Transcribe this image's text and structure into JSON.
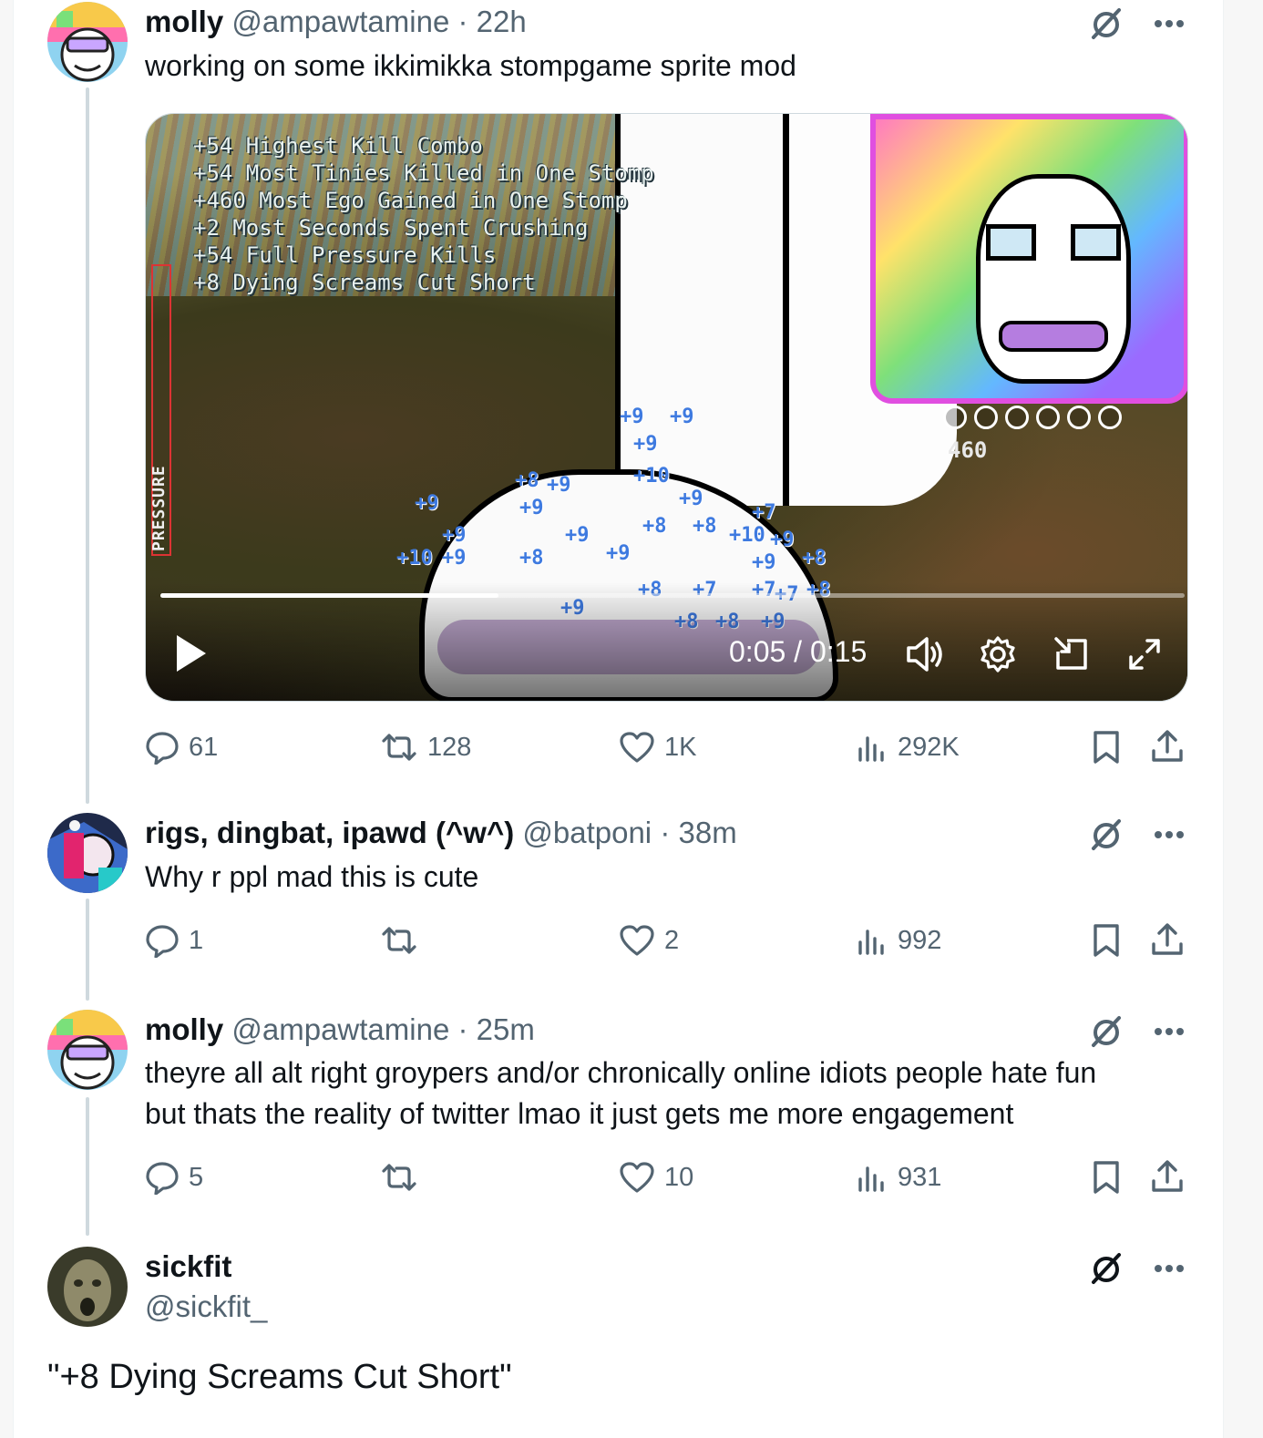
{
  "colors": {
    "text": "#0f1419",
    "muted": "#536471",
    "line": "#cfd9de"
  },
  "posts": [
    {
      "name": "molly",
      "handle": "@ampawtamine",
      "sep": "·",
      "time": "22h",
      "text": "working on some ikkimikka stompgame sprite mod",
      "stats": {
        "replies": "61",
        "reposts": "128",
        "likes": "1K",
        "views": "292K"
      }
    },
    {
      "name": "rigs, dingbat, ipawd (^w^)",
      "handle": "@batponi",
      "sep": "·",
      "time": "38m",
      "text": "Why r ppl mad this is cute",
      "stats": {
        "replies": "1",
        "reposts": "",
        "likes": "2",
        "views": "992"
      }
    },
    {
      "name": "molly",
      "handle": "@ampawtamine",
      "sep": "·",
      "time": "25m",
      "text_line1": "theyre all alt right groypers and/or chronically online idiots people hate fun",
      "text_line2": "but thats the reality of twitter lmao it just gets me more engagement",
      "stats": {
        "replies": "5",
        "reposts": "",
        "likes": "10",
        "views": "931"
      }
    },
    {
      "name": "sickfit",
      "handle": "@sickfit_",
      "quote": "\"+8 Dying Screams Cut Short\""
    }
  ],
  "video": {
    "hud_lines": "+54 Highest Kill Combo\n+54 Most Tinies Killed in One Stomp\n+460 Most Ego Gained in One Stomp\n+2 Most Seconds Spent Crushing\n+54 Full Pressure Kills\n+8 Dying Screams Cut Short",
    "pressure_label": "PRESSURE",
    "meter_score": "460",
    "time_display": "0:05 / 0:15",
    "progress": 0.33,
    "float_points": [
      "+9",
      "+9",
      "+9",
      "+10",
      "+9",
      "+8",
      "+9",
      "+9",
      "+9",
      "+9",
      "+10",
      "+9",
      "+8",
      "+9",
      "+9",
      "+8",
      "+8",
      "+10",
      "+9",
      "+7",
      "+9",
      "+8",
      "+8",
      "+7",
      "+7",
      "+8",
      "+8",
      "+9",
      "+7",
      "+8",
      "+9"
    ]
  },
  "icons": {
    "reply": "reply-icon",
    "repost": "repost-icon",
    "like": "heart-icon",
    "views": "views-icon",
    "bookmark": "bookmark-icon",
    "share": "share-icon",
    "grok": "grok-icon",
    "more": "more-icon",
    "play": "play-icon",
    "volume": "volume-icon",
    "settings": "gear-icon",
    "pip": "pip-icon",
    "fullscreen": "fullscreen-icon"
  }
}
